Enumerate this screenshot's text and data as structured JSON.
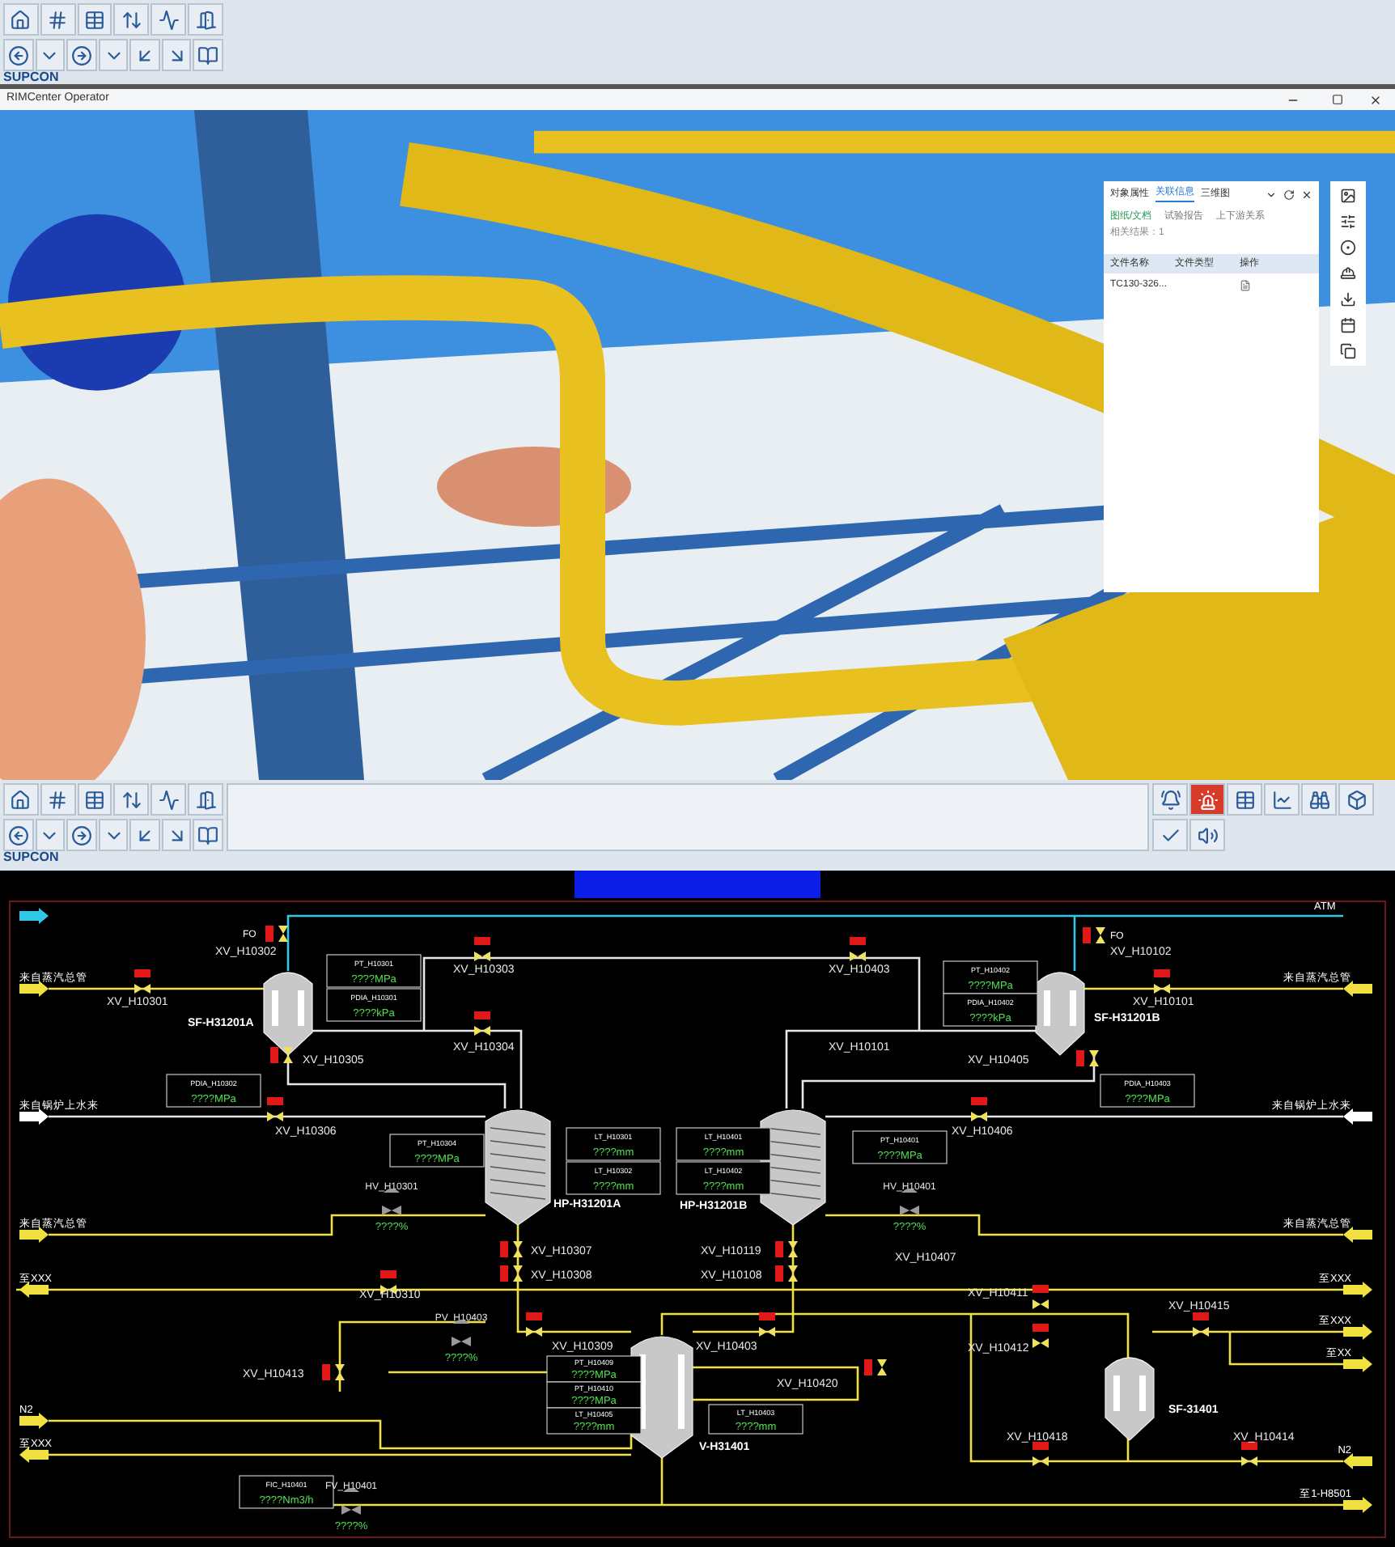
{
  "top_toolbar": {
    "logo": "SUPCON"
  },
  "viewer": {
    "title": "RIMCenter Operator",
    "panel": {
      "tabs": [
        {
          "label": "对象属性",
          "selected": false
        },
        {
          "label": "关联信息",
          "selected": true
        },
        {
          "label": "三维图",
          "selected": false
        }
      ],
      "subtabs": [
        {
          "label": "图纸/文档",
          "selected": true
        },
        {
          "label": "试验报告",
          "selected": false
        },
        {
          "label": "上下游关系",
          "selected": false
        }
      ],
      "result": "相关结果：1",
      "columns": [
        "文件名称",
        "文件类型",
        "操作"
      ],
      "rows": [
        [
          "TC130-326..."
        ]
      ]
    }
  },
  "bottom_toolbar": {
    "logo": "SUPCON",
    "alarm_active": true
  },
  "diagram": {
    "streams": [
      "ATM",
      "来自蒸汽总管",
      "来自蒸汽总管",
      "来自锅炉上水来",
      "来自锅炉上水来",
      "来自蒸汽总管",
      "来自蒸汽总管",
      "至XXX",
      "至XXX",
      "至XXX",
      "至XX",
      "N2",
      "至XXX",
      "N2",
      "至1-H8501"
    ],
    "valve_tags": [
      "XV_H10302",
      "XV_H10301",
      "XV_H10303",
      "XV_H10305",
      "XV_H10304",
      "XV_H10306",
      "XV_H10403",
      "XV_H10102",
      "XV_H10101",
      "XV_H10101",
      "XV_H10405",
      "XV_H10406",
      "XV_H10307",
      "XV_H10308",
      "XV_H10119",
      "XV_H10108",
      "XV_H10407",
      "XV_H10310",
      "XV_H10309",
      "XV_H10403",
      "XV_H10411",
      "XV_H10412",
      "XV_H10415",
      "XV_H10413",
      "XV_H10420",
      "XV_H10418",
      "XV_H10414"
    ],
    "equipment": [
      "SF-H31201A",
      "SF-H31201B",
      "HP-H31201A",
      "HP-H31201B",
      "V-H31401",
      "SF-31401"
    ],
    "readouts": [
      {
        "tag": "PT_H10301",
        "value": "????MPa"
      },
      {
        "tag": "PDIA_H10301",
        "value": "????kPa"
      },
      {
        "tag": "PDIA_H10302",
        "value": "????MPa"
      },
      {
        "tag": "PT_H10304",
        "value": "????MPa"
      },
      {
        "tag": "LT_H10301",
        "value": "????mm"
      },
      {
        "tag": "LT_H10302",
        "value": "????mm"
      },
      {
        "tag": "PT_H10402",
        "value": "????MPa"
      },
      {
        "tag": "PDIA_H10402",
        "value": "????kPa"
      },
      {
        "tag": "PDIA_H10403",
        "value": "????MPa"
      },
      {
        "tag": "LT_H10401",
        "value": "????mm"
      },
      {
        "tag": "LT_H10402",
        "value": "????mm"
      },
      {
        "tag": "PT_H10401",
        "value": "????MPa"
      },
      {
        "tag": "PT_H10409",
        "value": "????MPa"
      },
      {
        "tag": "PT_H10410",
        "value": "????MPa"
      },
      {
        "tag": "LT_H10405",
        "value": "????mm"
      },
      {
        "tag": "LT_H10403",
        "value": "????mm"
      },
      {
        "tag": "FIC_H10401",
        "value": "????Nm3/h"
      }
    ],
    "control_valves": [
      {
        "tag": "HV_H10301",
        "value": "????%"
      },
      {
        "tag": "HV_H10401",
        "value": "????%"
      },
      {
        "tag": "PV_H10403",
        "value": "????%"
      },
      {
        "tag": "FV_H10401",
        "value": "????%"
      }
    ],
    "fail_positions": [
      "FO",
      "FO"
    ]
  }
}
